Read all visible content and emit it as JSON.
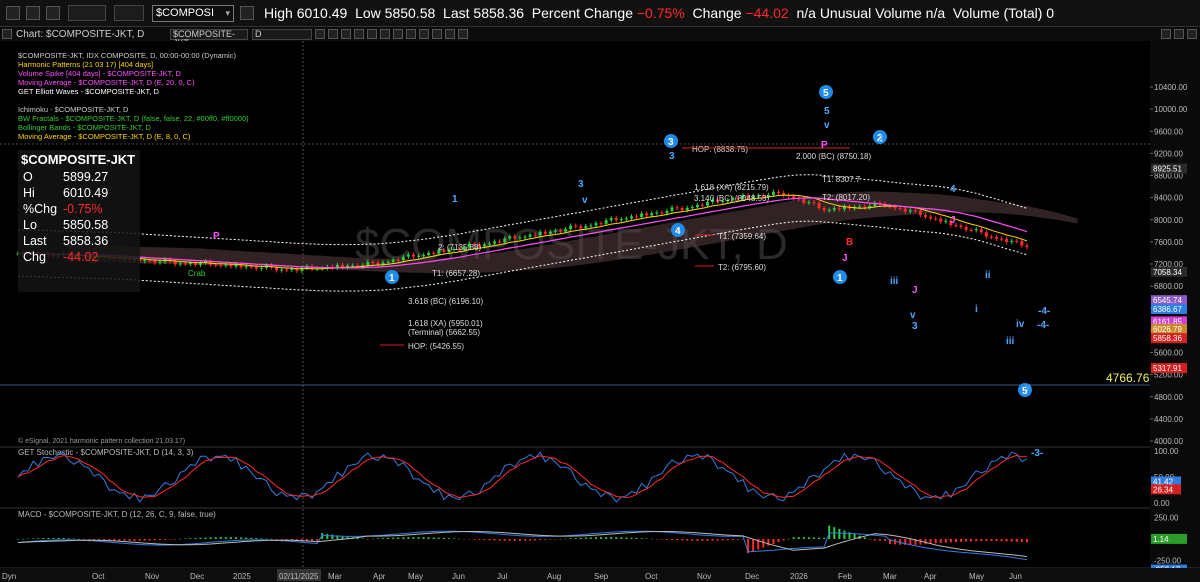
{
  "toolbar": {
    "symbol": "$COMPOSI",
    "high_label": "High",
    "high": "6010.49",
    "low_label": "Low",
    "low": "5850.58",
    "last_label": "Last",
    "last": "5858.36",
    "pct_label": "Percent Change",
    "pct": "−0.75%",
    "chg_label": "Change",
    "chg": "−44.02",
    "uv_label": "n/a  Unusual Volume",
    "uv": "n/a",
    "vol_label": "Volume (Total)",
    "vol": "0"
  },
  "window": {
    "title": "Chart: $COMPOSITE-JKT, D",
    "symbol_field": "$COMPOSITE-JKT",
    "interval_field": "D"
  },
  "legend": [
    {
      "text": "$COMPOSITE-JKT, IDX COMPOSITE, D, 00:00-00:00 (Dynamic)",
      "color": "#cccccc"
    },
    {
      "text": "Harmonic Patterns (21 03 17) [404 days]",
      "color": "#ffd700"
    },
    {
      "text": "Volume Spike [404 days] - $COMPOSITE-JKT, D",
      "color": "#ff4dff"
    },
    {
      "text": "Moving Average - $COMPOSITE-JKT, D (E, 20, 0, C)",
      "color": "#ff4dff"
    },
    {
      "text": "GET Elliott Waves - $COMPOSITE-JKT, D",
      "color": "#ffffff"
    },
    {
      "text": "",
      "color": "#ffffff"
    },
    {
      "text": "Ichimoku - $COMPOSITE-JKT, D",
      "color": "#cccccc"
    },
    {
      "text": "BW Fractals - $COMPOSITE-JKT, D (false, false, 22, #00ff0, #ff0000)",
      "color": "#33cc33"
    },
    {
      "text": "Bollinger Bands - $COMPOSITE-JKT, D",
      "color": "#33cc33"
    },
    {
      "text": "Moving Average - $COMPOSITE-JKT, D (E, 8, 0, C)",
      "color": "#ffd700"
    }
  ],
  "ohlc": {
    "symbol": "$COMPOSITE-JKT",
    "rows": [
      {
        "k": "O",
        "v": "5899.27"
      },
      {
        "k": "Hi",
        "v": "6010.49"
      },
      {
        "k": "%Chg",
        "v": "-0.75%"
      },
      {
        "k": "Lo",
        "v": "5850.58"
      },
      {
        "k": "Last",
        "v": "5858.36"
      },
      {
        "k": "Chg",
        "v": "-44.02"
      }
    ]
  },
  "watermark": "$COMPOSITE-JKT, D",
  "price_axis": [
    "10400.00",
    "10000.00",
    "9600.00",
    "9200.00",
    "8800.00",
    "8400.00",
    "8000.00",
    "7600.00",
    "7200.00",
    "6800.00",
    "6400.00",
    "6000.00",
    "5600.00",
    "5200.00",
    "4800.00",
    "4400.00",
    "4000.00"
  ],
  "price_tags": [
    {
      "text": "8925.51",
      "color": "#2a2a2a"
    },
    {
      "text": "7058.34",
      "color": "#2a2a2a"
    },
    {
      "text": "6545.74",
      "color": "#8a5cc8"
    },
    {
      "text": "6386.67",
      "color": "#2f7de0"
    },
    {
      "text": "6161.85",
      "color": "#d040d0"
    },
    {
      "text": "6026.79",
      "color": "#c88a2a"
    },
    {
      "text": "5858.36",
      "color": "#d42020"
    },
    {
      "text": "5317.91",
      "color": "#d42020"
    }
  ],
  "horizontal_level": "4766.76",
  "annotations": [
    "HOP: (8838.75)",
    "HOP: (5426.55)",
    "T1: (7359.64)",
    "T2: (6795.60)",
    "T1: (6657.28)",
    "3.618 (BC) (6196.10)",
    "1.618 (XA) (5950.01)",
    "3.140 (BC) (8048.53)",
    "1.618 (XA) (8215.79)",
    "2.000 (BC) (8750.18)",
    "T1: 8307.7",
    "T2: (8017.20)",
    "(Terminal) (5662.55)",
    "2: (7135.88)",
    "Crab"
  ],
  "footer_note": "© eSignal, 2021 harmonic pattern collection 21.03.17)",
  "stochastic": {
    "title": "GET Stochastic - $COMPOSITE-JKT, D (14, 3, 3)",
    "axis": [
      "100.00",
      "50.00",
      "0.00"
    ],
    "tags": [
      {
        "text": "41.42",
        "color": "#2f7de0"
      },
      {
        "text": "26.34",
        "color": "#d42020"
      }
    ]
  },
  "macd": {
    "title": "MACD - $COMPOSITE-JKT, D (12, 26, C, 9, false, true)",
    "axis": [
      "250.00",
      "0.00",
      "-250.00"
    ],
    "tags": [
      {
        "text": "1.14",
        "color": "#2a9d2a"
      },
      {
        "text": "-353.17",
        "color": "#2f7de0"
      }
    ]
  },
  "time_axis": [
    "Dyn",
    "Oct",
    "Nov",
    "Dec",
    "2025",
    "02/11/2025",
    "Mar",
    "Apr",
    "May",
    "Jun",
    "Jul",
    "Aug",
    "Sep",
    "Oct",
    "Nov",
    "Dec",
    "2026",
    "Feb",
    "Mar",
    "Apr",
    "May",
    "Jun"
  ],
  "wave_labels": [
    "5",
    "5",
    "v",
    "2",
    "3",
    "3",
    "4",
    "1",
    "1",
    "3",
    "v",
    "4",
    "3",
    "5",
    "iii",
    "v",
    "i",
    "ii",
    "iii",
    "iv",
    "v",
    "-4-",
    "-3-",
    "-4-",
    "1",
    "2",
    "B",
    "J",
    "J",
    "J",
    "P",
    "P"
  ],
  "colors": {
    "background": "#000000",
    "accent": "#1f6fd8",
    "down": "#ff2a2a",
    "up": "#2ecc40"
  }
}
